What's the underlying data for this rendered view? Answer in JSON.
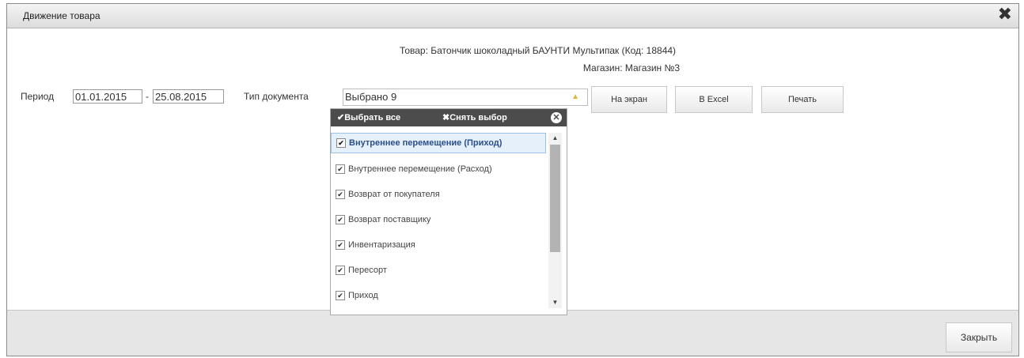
{
  "dialog": {
    "title": "Движение товара",
    "close_icon": "close-x-icon"
  },
  "info": {
    "product": "Товар: Батончик шоколадный БАУНТИ Мультипак (Код: 18844)",
    "store": "Магазин: Магазин №3"
  },
  "filters": {
    "period_label": "Период",
    "date_from": "01.01.2015",
    "date_sep": "-",
    "date_to": "25.08.2015",
    "doc_type_label": "Тип документа",
    "doc_type_value": "Выбрано 9"
  },
  "buttons": {
    "screen": "На экран",
    "excel": "В Excel",
    "print": "Печать"
  },
  "dropdown": {
    "select_all": "✔Выбрать все",
    "clear": "✖Снять выбор",
    "items": [
      {
        "label": "Внутреннее перемещение (Приход)",
        "checked": true
      },
      {
        "label": "Внутреннее перемещение (Расход)",
        "checked": true
      },
      {
        "label": "Возврат от покупателя",
        "checked": true
      },
      {
        "label": "Возврат поставщику",
        "checked": true
      },
      {
        "label": "Инвентаризация",
        "checked": true
      },
      {
        "label": "Пересорт",
        "checked": true
      },
      {
        "label": "Приход",
        "checked": true
      }
    ]
  },
  "footer": {
    "close_label": "Закрыть"
  }
}
